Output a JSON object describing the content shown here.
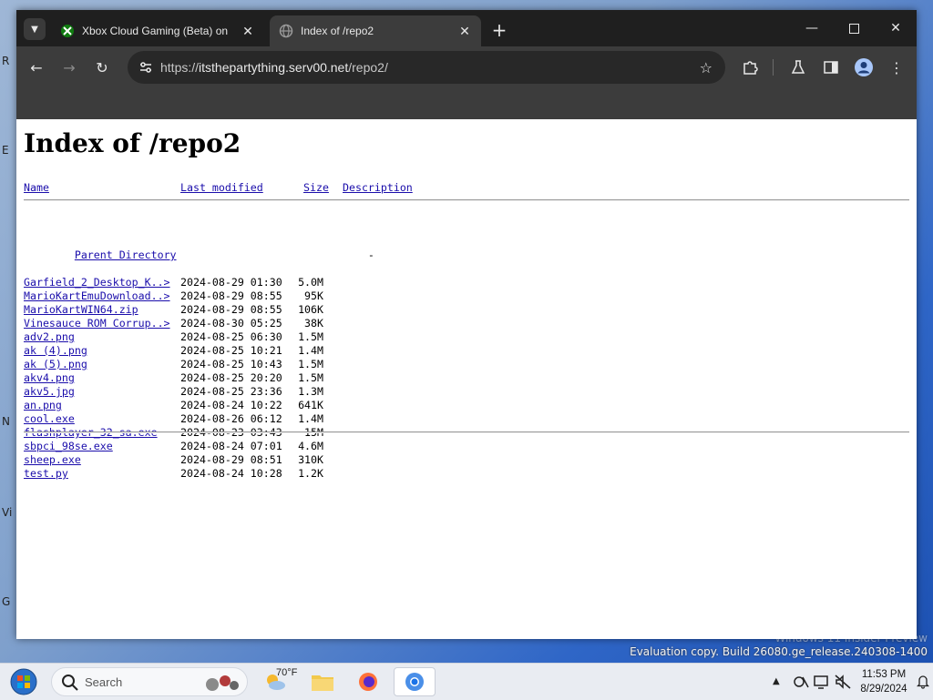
{
  "browser": {
    "tabs": [
      {
        "title": "Xbox Cloud Gaming (Beta) on",
        "active": false
      },
      {
        "title": "Index of /repo2",
        "active": true
      }
    ],
    "url": {
      "scheme": "https://",
      "host": "itsthepartything.serv00.net",
      "path": "/repo2/"
    }
  },
  "page": {
    "heading": "Index of /repo2",
    "columns": {
      "name": "Name",
      "modified": "Last modified",
      "size": "Size",
      "description": "Description"
    },
    "parent": {
      "name": "Parent Directory",
      "size": "-"
    },
    "rows": [
      {
        "name": "Garfield_2_Desktop_K..>",
        "date": "2024-08-29 01:30",
        "size": "5.0M"
      },
      {
        "name": "MarioKartEmuDownload..>",
        "date": "2024-08-29 08:55",
        "size": "95K"
      },
      {
        "name": "MarioKartWIN64.zip",
        "date": "2024-08-29 08:55",
        "size": "106K"
      },
      {
        "name": "Vinesauce ROM Corrup..>",
        "date": "2024-08-30 05:25",
        "size": "38K"
      },
      {
        "name": "adv2.png",
        "date": "2024-08-25 06:30",
        "size": "1.5M"
      },
      {
        "name": "ak (4).png",
        "date": "2024-08-25 10:21",
        "size": "1.4M"
      },
      {
        "name": "ak (5).png",
        "date": "2024-08-25 10:43",
        "size": "1.5M"
      },
      {
        "name": "akv4.png",
        "date": "2024-08-25 20:20",
        "size": "1.5M"
      },
      {
        "name": "akv5.jpg",
        "date": "2024-08-25 23:36",
        "size": "1.3M"
      },
      {
        "name": "an.png",
        "date": "2024-08-24 10:22",
        "size": "641K"
      },
      {
        "name": "cool.exe",
        "date": "2024-08-26 06:12",
        "size": "1.4M"
      },
      {
        "name": "flashplayer_32_sa.exe",
        "date": "2024-08-23 03:43",
        "size": "15M"
      },
      {
        "name": "sbpci_98se.exe",
        "date": "2024-08-24 07:01",
        "size": "4.6M"
      },
      {
        "name": "sheep.exe",
        "date": "2024-08-29 08:51",
        "size": "310K"
      },
      {
        "name": "test.py",
        "date": "2024-08-24 10:28",
        "size": "1.2K"
      }
    ]
  },
  "desktop": {
    "watermark_line1": "Windows 11 Insider Preview",
    "watermark_line2": "Evaluation copy. Build 26080.ge_release.240308-1400",
    "edge_letters": [
      "R",
      "E",
      "N",
      "Vi",
      "G"
    ]
  },
  "taskbar": {
    "search_placeholder": "Search",
    "weather_temp": "70°F",
    "time": "11:53 PM",
    "date": "8/29/2024"
  },
  "colors": {
    "chrome_dark": "#1f1f1f",
    "chrome_toolbar": "#3c3c3c",
    "link": "#1a0dab",
    "taskbar": "#e9ecf2"
  }
}
